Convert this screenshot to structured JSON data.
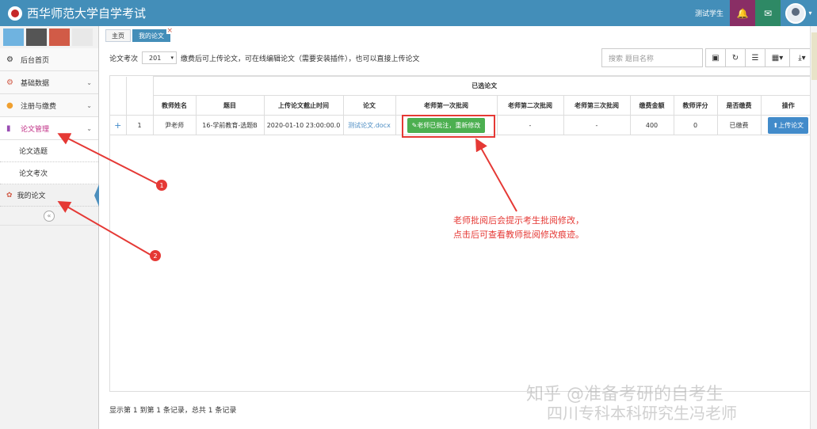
{
  "app": {
    "title": "西华师范大学自学考试"
  },
  "header": {
    "user": "测试学生",
    "bell_icon": "bell-icon",
    "mail_icon": "envelope-icon"
  },
  "sidebar": {
    "shortcut_colors": [
      "#6fb3e0",
      "#555555",
      "#d15b47",
      "#e8e8e8"
    ],
    "items": [
      {
        "label": "后台首页",
        "icon": "dashboard-icon"
      },
      {
        "label": "基础数据",
        "icon": "cogs-icon"
      },
      {
        "label": "注册与缴费",
        "icon": "comments-icon"
      },
      {
        "label": "论文管理",
        "icon": "book-icon"
      }
    ],
    "sub_items": [
      "论文选题",
      "论文考次",
      "我的论文"
    ],
    "collapse": "«"
  },
  "tabs": [
    {
      "label": "主页"
    },
    {
      "label": "我的论文"
    }
  ],
  "toolbar": {
    "prefix": "论文考次",
    "select_value": "201",
    "notice": "缴费后可上传论文，可在线编辑论文（需要安装插件），也可以直接上传论文"
  },
  "search": {
    "placeholder": "搜索 题目名称"
  },
  "table": {
    "group_header": "已选论文",
    "columns": [
      "序号",
      "教师姓名",
      "题目",
      "上传论文截止时间",
      "论文",
      "老师第一次批阅",
      "老师第二次批阅",
      "老师第三次批阅",
      "缴费金额",
      "教师评分",
      "是否缴费",
      "操作"
    ],
    "rows": [
      {
        "expand": "+",
        "index": "1",
        "teacher": "尹老师",
        "topic": "16-学前教育-选题B",
        "deadline": "2020-01-10 23:00:00.0",
        "paper": "测试论文.docx",
        "review1": "✎老师已批注，重新修改",
        "review2": "-",
        "review3": "-",
        "fee": "400",
        "score": "0",
        "paid": "已缴费",
        "action": "⬆上传论文"
      }
    ]
  },
  "annotation": {
    "line1": "老师批阅后会提示考生批阅修改，",
    "line2": "点击后可查看教师批阅修改痕迹。",
    "badge1": "1",
    "badge2": "2"
  },
  "footer": {
    "summary": "显示第 1 到第 1 条记录，总共 1 条记录"
  },
  "watermark": {
    "line1": "知乎 @准备考研的自考生",
    "line2": "四川专科本科研究生冯老师"
  }
}
